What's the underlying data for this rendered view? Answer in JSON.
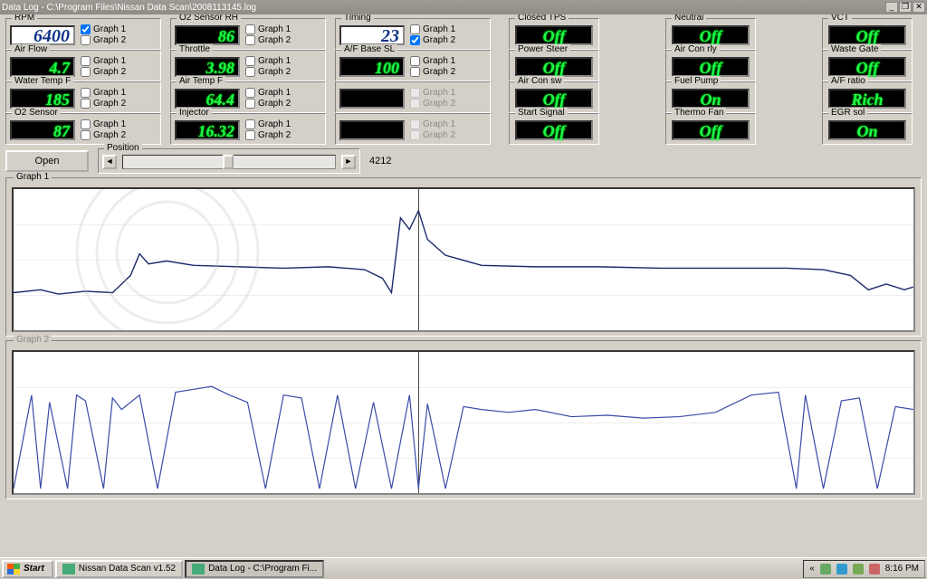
{
  "window": {
    "title": "Data Log - C:\\Program Files\\Nissan Data Scan\\2008113145.log",
    "btn_min": "_",
    "btn_max": "❐",
    "btn_close": "✕"
  },
  "labels": {
    "graph1": "Graph 1",
    "graph2": "Graph 2",
    "open": "Open",
    "position": "Position"
  },
  "position": {
    "value": "4212",
    "min": 0,
    "max": 9000,
    "thumb_pct": 47
  },
  "sensors": {
    "row0": [
      {
        "cap": "RPM",
        "val": "6400",
        "white": true,
        "g1": true,
        "g2": false
      },
      {
        "cap": "O2 Sensor RH",
        "val": "86",
        "white": false,
        "g1": false,
        "g2": false
      },
      {
        "cap": "Timing",
        "val": "23",
        "white": true,
        "g1": false,
        "g2": true
      }
    ],
    "row1": [
      {
        "cap": "Air Flow",
        "val": "4.7",
        "white": false,
        "g1": false,
        "g2": false
      },
      {
        "cap": "Throttle",
        "val": "3.98",
        "white": false,
        "g1": false,
        "g2": false
      },
      {
        "cap": "A/F Base SL",
        "val": "100",
        "white": false,
        "g1": false,
        "g2": false
      }
    ],
    "row2": [
      {
        "cap": "Water Temp F",
        "val": "185",
        "white": false,
        "g1": false,
        "g2": false
      },
      {
        "cap": "Air Temp F",
        "val": "64.4",
        "white": false,
        "g1": false,
        "g2": false
      },
      {
        "cap": "",
        "val": "",
        "white": false,
        "g1": false,
        "g2": false,
        "disabled": true
      }
    ],
    "row3": [
      {
        "cap": "O2 Sensor",
        "val": "87",
        "white": false,
        "g1": false,
        "g2": false
      },
      {
        "cap": "Injector",
        "val": "16.32",
        "white": false,
        "g1": false,
        "g2": false
      },
      {
        "cap": "",
        "val": "",
        "white": false,
        "g1": false,
        "g2": false,
        "disabled": true
      }
    ]
  },
  "status": {
    "row0": [
      {
        "cap": "Closed TPS",
        "val": "Off"
      },
      {
        "cap": "Neutral",
        "val": "Off"
      },
      {
        "cap": "VCT",
        "val": "Off"
      }
    ],
    "row1": [
      {
        "cap": "Power Steer",
        "val": "Off"
      },
      {
        "cap": "Air Con rly",
        "val": "Off"
      },
      {
        "cap": "Waste Gate",
        "val": "Off"
      }
    ],
    "row2": [
      {
        "cap": "Air Con sw",
        "val": "Off"
      },
      {
        "cap": "Fuel Pump",
        "val": "On"
      },
      {
        "cap": "A/F ratio",
        "val": "Rich"
      }
    ],
    "row3": [
      {
        "cap": "Start Signal",
        "val": "Off"
      },
      {
        "cap": "Thermo Fan",
        "val": "Off"
      },
      {
        "cap": "EGR sol",
        "val": "On"
      }
    ]
  },
  "graphs": {
    "g1": {
      "cap": "Graph 1",
      "cursor_pct": 45
    },
    "g2": {
      "cap": "Graph 2",
      "cursor_pct": 45
    }
  },
  "taskbar": {
    "start": "Start",
    "items": [
      {
        "label": "Nissan Data Scan v1.52",
        "active": false
      },
      {
        "label": "Data Log - C:\\Program Fi...",
        "active": true
      }
    ],
    "clock": "8:16 PM",
    "tray_chevron": "«"
  },
  "chart_data": [
    {
      "type": "line",
      "title": "Graph 1",
      "series": [
        {
          "name": "RPM",
          "x_pct": [
            0,
            3,
            5,
            8,
            11,
            13,
            14,
            15,
            17,
            20,
            25,
            30,
            35,
            39,
            41,
            42,
            43,
            44,
            45,
            46,
            48,
            52,
            58,
            65,
            72,
            80,
            86,
            90,
            93,
            95,
            97,
            99,
            100
          ],
          "y_pct": [
            72,
            70,
            73,
            71,
            72,
            60,
            45,
            52,
            50,
            53,
            54,
            55,
            54,
            56,
            62,
            72,
            20,
            28,
            15,
            35,
            46,
            53,
            54,
            54,
            55,
            55,
            55,
            56,
            60,
            70,
            66,
            70,
            68
          ]
        }
      ],
      "xlabel": "",
      "ylabel": "",
      "ylim": [
        0,
        100
      ],
      "cursor_pct": 45
    },
    {
      "type": "line",
      "title": "Graph 2",
      "series": [
        {
          "name": "Timing",
          "x_pct": [
            0,
            2,
            3,
            4,
            6,
            7,
            8,
            10,
            11,
            12,
            14,
            16,
            18,
            20,
            22,
            24,
            26,
            28,
            30,
            32,
            34,
            36,
            38,
            40,
            42,
            44,
            45,
            46,
            48,
            50,
            52,
            55,
            58,
            62,
            66,
            70,
            74,
            78,
            82,
            85,
            87,
            88,
            90,
            92,
            94,
            96,
            98,
            100
          ],
          "y_pct": [
            95,
            30,
            95,
            35,
            95,
            30,
            34,
            95,
            32,
            40,
            30,
            95,
            28,
            26,
            24,
            30,
            35,
            95,
            30,
            32,
            95,
            30,
            95,
            35,
            95,
            30,
            95,
            36,
            95,
            38,
            40,
            42,
            40,
            45,
            44,
            46,
            45,
            42,
            30,
            28,
            95,
            30,
            95,
            34,
            32,
            95,
            38,
            40
          ]
        }
      ],
      "xlabel": "",
      "ylabel": "",
      "ylim": [
        0,
        100
      ],
      "cursor_pct": 45
    }
  ]
}
